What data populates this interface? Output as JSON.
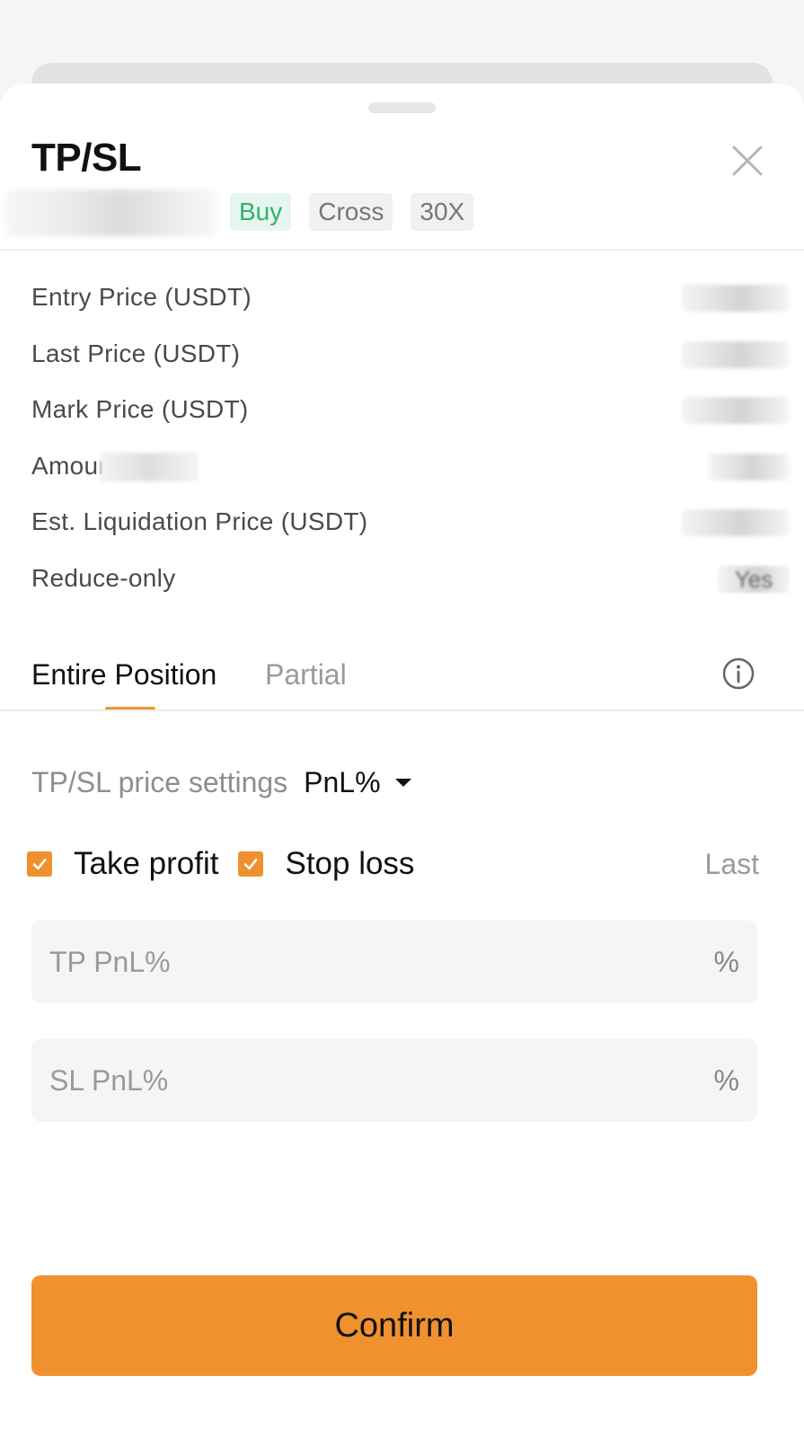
{
  "sheet": {
    "title": "TP/SL",
    "tags": {
      "side": "Buy",
      "margin_mode": "Cross",
      "leverage": "30X"
    }
  },
  "info_rows": [
    {
      "label": "Entry Price (USDT)",
      "value": ""
    },
    {
      "label": "Last Price (USDT)",
      "value": ""
    },
    {
      "label": "Mark Price (USDT)",
      "value": ""
    },
    {
      "label": "Amour",
      "value": ""
    },
    {
      "label": "Est. Liquidation Price (USDT)",
      "value": ""
    },
    {
      "label": "Reduce-only",
      "value": "Yes"
    }
  ],
  "tabs": {
    "entire": "Entire Position",
    "partial": "Partial",
    "active": "entire"
  },
  "settings": {
    "label": "TP/SL price settings",
    "selected": "PnL%"
  },
  "checks": {
    "take_profit": {
      "label": "Take profit",
      "checked": true
    },
    "stop_loss": {
      "label": "Stop loss",
      "checked": true
    },
    "trigger_type": "Last"
  },
  "fields": {
    "tp": {
      "placeholder": "TP PnL%",
      "unit": "%"
    },
    "sl": {
      "placeholder": "SL PnL%",
      "unit": "%"
    }
  },
  "confirm_label": "Confirm",
  "colors": {
    "accent": "#f0912f",
    "buy": "#2fb36f",
    "buy_bg": "#e6f6ee"
  },
  "icons": [
    "close-icon",
    "info-icon",
    "caret-down-icon",
    "checkmark-icon"
  ]
}
